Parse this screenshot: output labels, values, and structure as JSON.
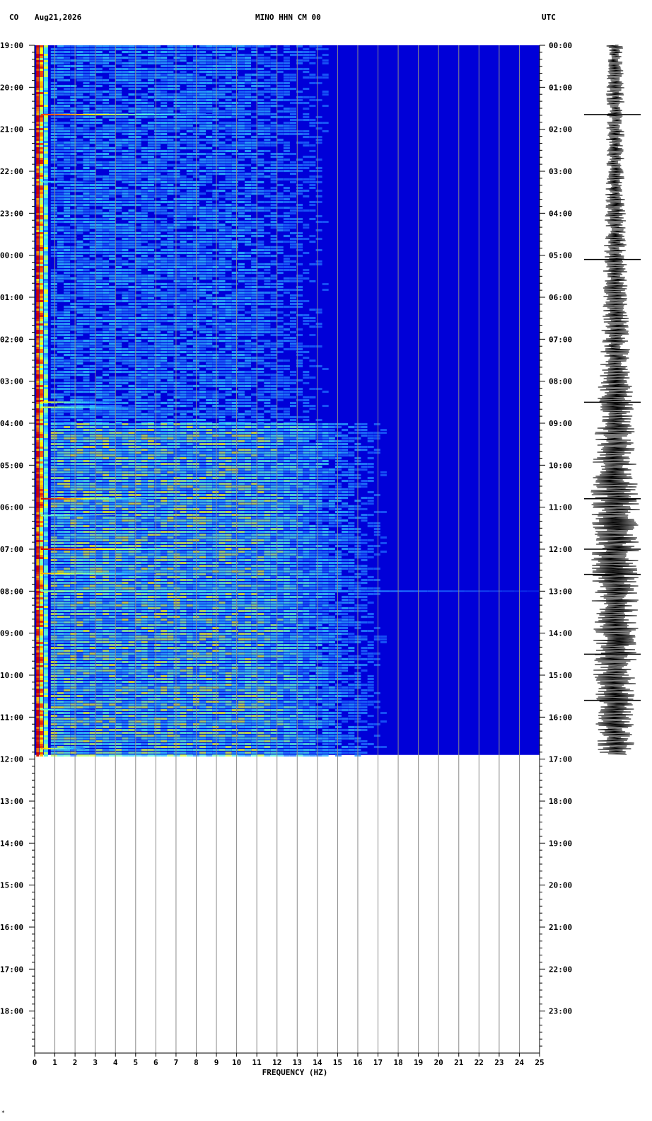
{
  "header": {
    "network": "CO",
    "date": "Aug21,2026",
    "station": "MINO HHN CM 00",
    "timezone": "UTC"
  },
  "corner_mark": "*",
  "chart_data": {
    "type": "heatmap",
    "title": "MINO HHN CM 00",
    "xlabel": "FREQUENCY (HZ)",
    "ylabel": "",
    "xlim": [
      0,
      25
    ],
    "x_ticks": [
      0,
      1,
      2,
      3,
      4,
      5,
      6,
      7,
      8,
      9,
      10,
      11,
      12,
      13,
      14,
      15,
      16,
      17,
      18,
      19,
      20,
      21,
      22,
      23,
      24,
      25
    ],
    "x_tick_labels": [
      "0",
      "1",
      "2",
      "3",
      "4",
      "5",
      "6",
      "7",
      "8",
      "9",
      "10",
      "11",
      "12",
      "13",
      "14",
      "15",
      "16",
      "17",
      "18",
      "19",
      "20",
      "21",
      "22",
      "23",
      "24",
      "25"
    ],
    "y_hours_total": 24,
    "y_left_labels": [
      "19:00",
      "20:00",
      "21:00",
      "22:00",
      "23:00",
      "00:00",
      "01:00",
      "02:00",
      "03:00",
      "04:00",
      "05:00",
      "06:00",
      "07:00",
      "08:00",
      "09:00",
      "10:00",
      "11:00",
      "12:00",
      "13:00",
      "14:00",
      "15:00",
      "16:00",
      "17:00",
      "18:00"
    ],
    "y_right_labels": [
      "00:00",
      "01:00",
      "02:00",
      "03:00",
      "04:00",
      "05:00",
      "06:00",
      "07:00",
      "08:00",
      "09:00",
      "10:00",
      "11:00",
      "12:00",
      "13:00",
      "14:00",
      "15:00",
      "16:00",
      "17:00",
      "18:00",
      "19:00",
      "20:00",
      "21:00",
      "22:00",
      "23:00"
    ],
    "data_end_hours": 16.9,
    "grid": true,
    "colormap": [
      "#00008b",
      "#0000d8",
      "#1e6bff",
      "#33ccff",
      "#66ffcc",
      "#ffff00",
      "#ff6600",
      "#cc0000"
    ],
    "noise_bands": [
      {
        "from_h": 0,
        "to_h": 9.0,
        "freq_max": 10,
        "level": 0.22
      },
      {
        "from_h": 9.0,
        "to_h": 16.9,
        "freq_max": 11,
        "level": 0.42
      }
    ],
    "events": [
      {
        "hour": 1.65,
        "freq_max": 9,
        "intensity": 0.9
      },
      {
        "hour": 3.25,
        "freq_max": 3,
        "intensity": 0.5
      },
      {
        "hour": 8.5,
        "freq_max": 4,
        "intensity": 0.75
      },
      {
        "hour": 8.62,
        "freq_max": 5,
        "intensity": 0.7
      },
      {
        "hour": 10.8,
        "freq_max": 5.5,
        "intensity": 1.0
      },
      {
        "hour": 11.2,
        "freq_max": 4,
        "intensity": 0.6
      },
      {
        "hour": 12.0,
        "freq_max": 8,
        "intensity": 1.0
      },
      {
        "hour": 12.58,
        "freq_max": 6,
        "intensity": 0.8
      },
      {
        "hour": 13.0,
        "freq_max": 25,
        "intensity": 0.6
      },
      {
        "hour": 15.82,
        "freq_max": 3,
        "intensity": 0.6
      },
      {
        "hour": 16.75,
        "freq_max": 2.5,
        "intensity": 0.8
      }
    ],
    "waveform": {
      "amplitude_profile": [
        {
          "hour": 0,
          "amp": 0.35
        },
        {
          "hour": 3,
          "amp": 0.35
        },
        {
          "hour": 5,
          "amp": 0.45
        },
        {
          "hour": 7,
          "amp": 0.55
        },
        {
          "hour": 9,
          "amp": 0.75
        },
        {
          "hour": 10.5,
          "amp": 0.95
        },
        {
          "hour": 13,
          "amp": 0.9
        },
        {
          "hour": 15,
          "amp": 0.85
        },
        {
          "hour": 16.9,
          "amp": 0.7
        }
      ],
      "spikes_hours": [
        1.65,
        5.1,
        8.5,
        10.8,
        12.0,
        12.6,
        14.5,
        15.6
      ]
    }
  }
}
